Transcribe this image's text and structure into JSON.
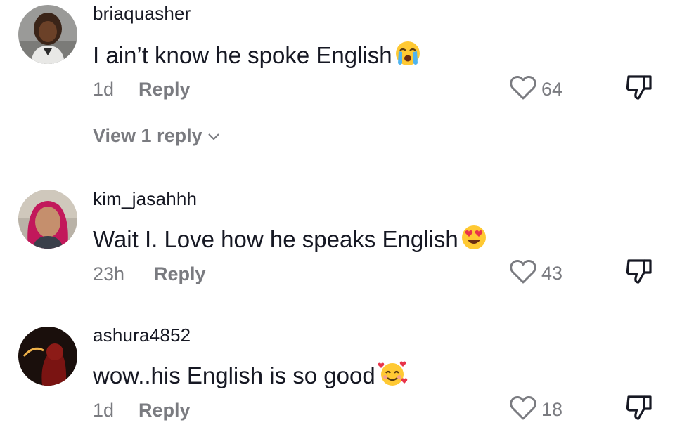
{
  "comments": [
    {
      "username": "briaquasher",
      "text": "I ain’t know he spoke English",
      "emoji": "loudly-crying-face-emoji",
      "time": "1d",
      "reply_label": "Reply",
      "likes": "64",
      "view_replies": "View 1 reply"
    },
    {
      "username": "kim_jasahhh",
      "text": "Wait I. Love how he speaks English",
      "emoji": "heart-eyes-emoji",
      "time": "23h",
      "reply_label": "Reply",
      "likes": "43"
    },
    {
      "username": "ashura4852",
      "text": "wow..his English is so good",
      "emoji": "smiling-face-with-hearts-emoji",
      "time": "1d",
      "reply_label": "Reply",
      "likes": "18"
    }
  ],
  "icons": {
    "like": "heart-outline-icon",
    "dislike": "thumbs-down-icon",
    "expand": "chevron-down-icon"
  },
  "colors": {
    "text": "#161823",
    "muted": "#7a7b80",
    "background": "#ffffff"
  }
}
